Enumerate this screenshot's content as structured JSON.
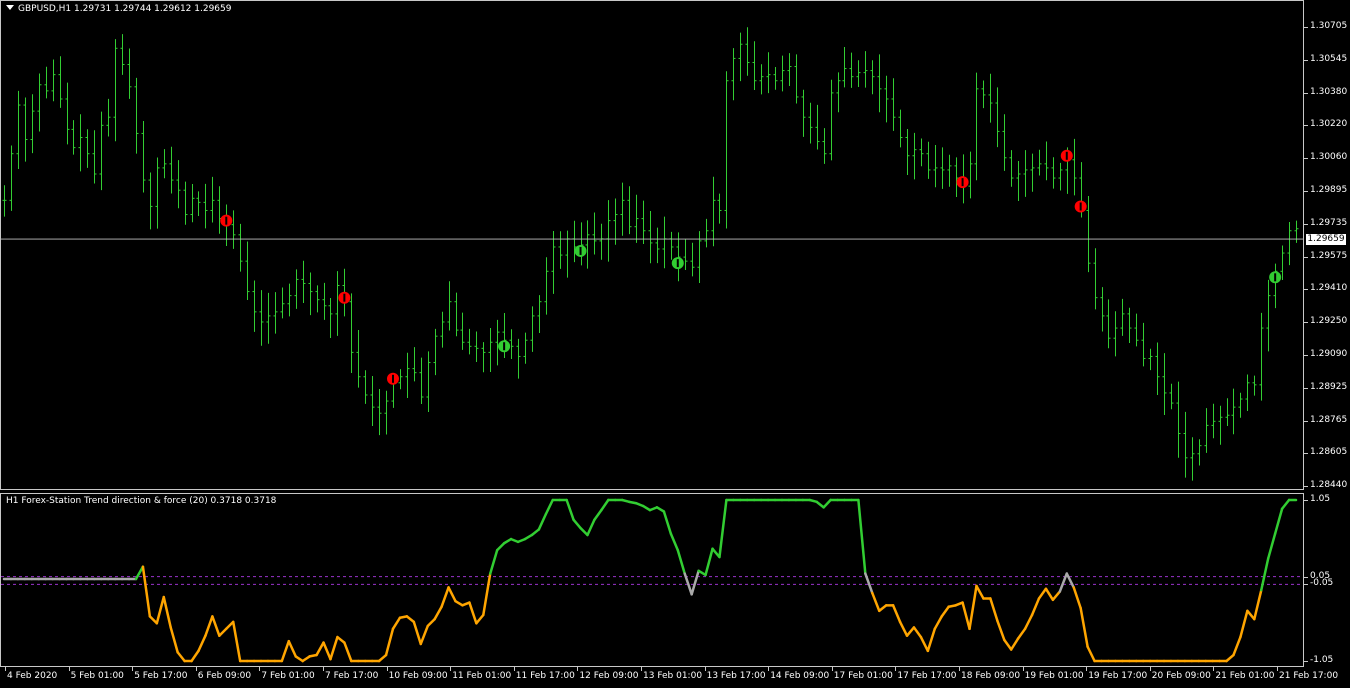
{
  "chart_title": "GBPUSD,H1  1.29731 1.29744 1.29612 1.29659",
  "indicator_title": "H1 Forex-Station Trend direction & force (20) 0.3718 0.3718",
  "current_price": "1.29659",
  "price_axis": [
    "1.30705",
    "1.30545",
    "1.30380",
    "1.30220",
    "1.30060",
    "1.29895",
    "1.29735",
    "1.29575",
    "1.29410",
    "1.29250",
    "1.29090",
    "1.28925",
    "1.28765",
    "1.28605",
    "1.28440"
  ],
  "indicator_axis": [
    "1.05",
    "0.05",
    "-0.05",
    "-1.05"
  ],
  "time_axis": [
    "4 Feb 2020",
    "5 Feb 01:00",
    "5 Feb 17:00",
    "6 Feb 09:00",
    "7 Feb 01:00",
    "7 Feb 17:00",
    "10 Feb 09:00",
    "11 Feb 01:00",
    "11 Feb 17:00",
    "12 Feb 09:00",
    "13 Feb 01:00",
    "13 Feb 17:00",
    "14 Feb 09:00",
    "17 Feb 01:00",
    "17 Feb 17:00",
    "18 Feb 09:00",
    "19 Feb 01:00",
    "19 Feb 17:00",
    "20 Feb 09:00",
    "21 Feb 01:00",
    "21 Feb 17:00"
  ],
  "colors": {
    "background": "#000000",
    "bars": "#32cd32",
    "bullish_line": "#32cd32",
    "bearish_line": "#ffa500",
    "neutral_line": "#a9a9a9",
    "levels": "#9932cc",
    "sell_signal": "#ff0000",
    "buy_signal": "#32cd32",
    "price_line": "#c0c0c0"
  },
  "chart_data": {
    "type": "line",
    "ylim": [
      1.2844,
      1.3078
    ],
    "close": [
      1.2985,
      1.3008,
      1.3032,
      1.3015,
      1.3029,
      1.3042,
      1.3039,
      1.3047,
      1.3035,
      1.302,
      1.3011,
      1.3016,
      1.3008,
      1.2998,
      1.3022,
      1.3026,
      1.306,
      1.3052,
      1.3041,
      1.3018,
      1.2995,
      1.2982,
      1.3001,
      1.3003,
      1.2995,
      1.299,
      1.2978,
      1.2986,
      1.2984,
      1.298,
      1.2985,
      1.2976,
      1.2973,
      1.2968,
      1.2955,
      1.294,
      1.293,
      1.2925,
      1.2928,
      1.293,
      1.2934,
      1.2938,
      1.2946,
      1.2944,
      1.294,
      1.2936,
      1.2933,
      1.2929,
      1.2943,
      1.2935,
      1.291,
      1.2898,
      1.2889,
      1.2883,
      1.288,
      1.2886,
      1.2895,
      1.2898,
      1.2902,
      1.29,
      1.2888,
      1.2905,
      1.2918,
      1.2925,
      1.2935,
      1.2921,
      1.2915,
      1.2913,
      1.2912,
      1.291,
      1.2915,
      1.292,
      1.2916,
      1.2913,
      1.2908,
      1.2916,
      1.2928,
      1.2935,
      1.295,
      1.2962,
      1.2958,
      1.2966,
      1.2962,
      1.2963,
      1.2968,
      1.2965,
      1.2966,
      1.2975,
      1.2978,
      1.2985,
      1.2972,
      1.2976,
      1.297,
      1.2964,
      1.2961,
      1.2966,
      1.2962,
      1.2957,
      1.2955,
      1.2952,
      1.2965,
      1.297,
      1.2985,
      1.298,
      1.3044,
      1.3055,
      1.3062,
      1.3053,
      1.3044,
      1.3046,
      1.3047,
      1.3044,
      1.3049,
      1.3051,
      1.3036,
      1.3026,
      1.3021,
      1.3014,
      1.3008,
      1.3038,
      1.3044,
      1.305,
      1.3046,
      1.3048,
      1.3049,
      1.3046,
      1.304,
      1.3035,
      1.3026,
      1.3016,
      1.3007,
      1.301,
      1.3008,
      1.3,
      1.3001,
      1.3,
      1.3002,
      1.2996,
      1.2992,
      1.3003,
      1.304,
      1.3037,
      1.3033,
      1.3019,
      1.3006,
      1.2996,
      1.2998,
      1.3,
      1.3001,
      1.3003,
      1.3001,
      1.2996,
      1.3,
      1.3005,
      1.2996,
      1.298,
      1.2954,
      1.2937,
      1.2928,
      1.2917,
      1.2922,
      1.2929,
      1.2922,
      1.2916,
      1.2907,
      1.2908,
      1.2898,
      1.289,
      1.2885,
      1.287,
      1.2858,
      1.286,
      1.2864,
      1.2874,
      1.2876,
      1.2878,
      1.2879,
      1.2883,
      1.2887,
      1.2895,
      1.2894,
      1.2922,
      1.2938,
      1.295,
      1.2959,
      1.297,
      1.2971
    ]
  }
}
